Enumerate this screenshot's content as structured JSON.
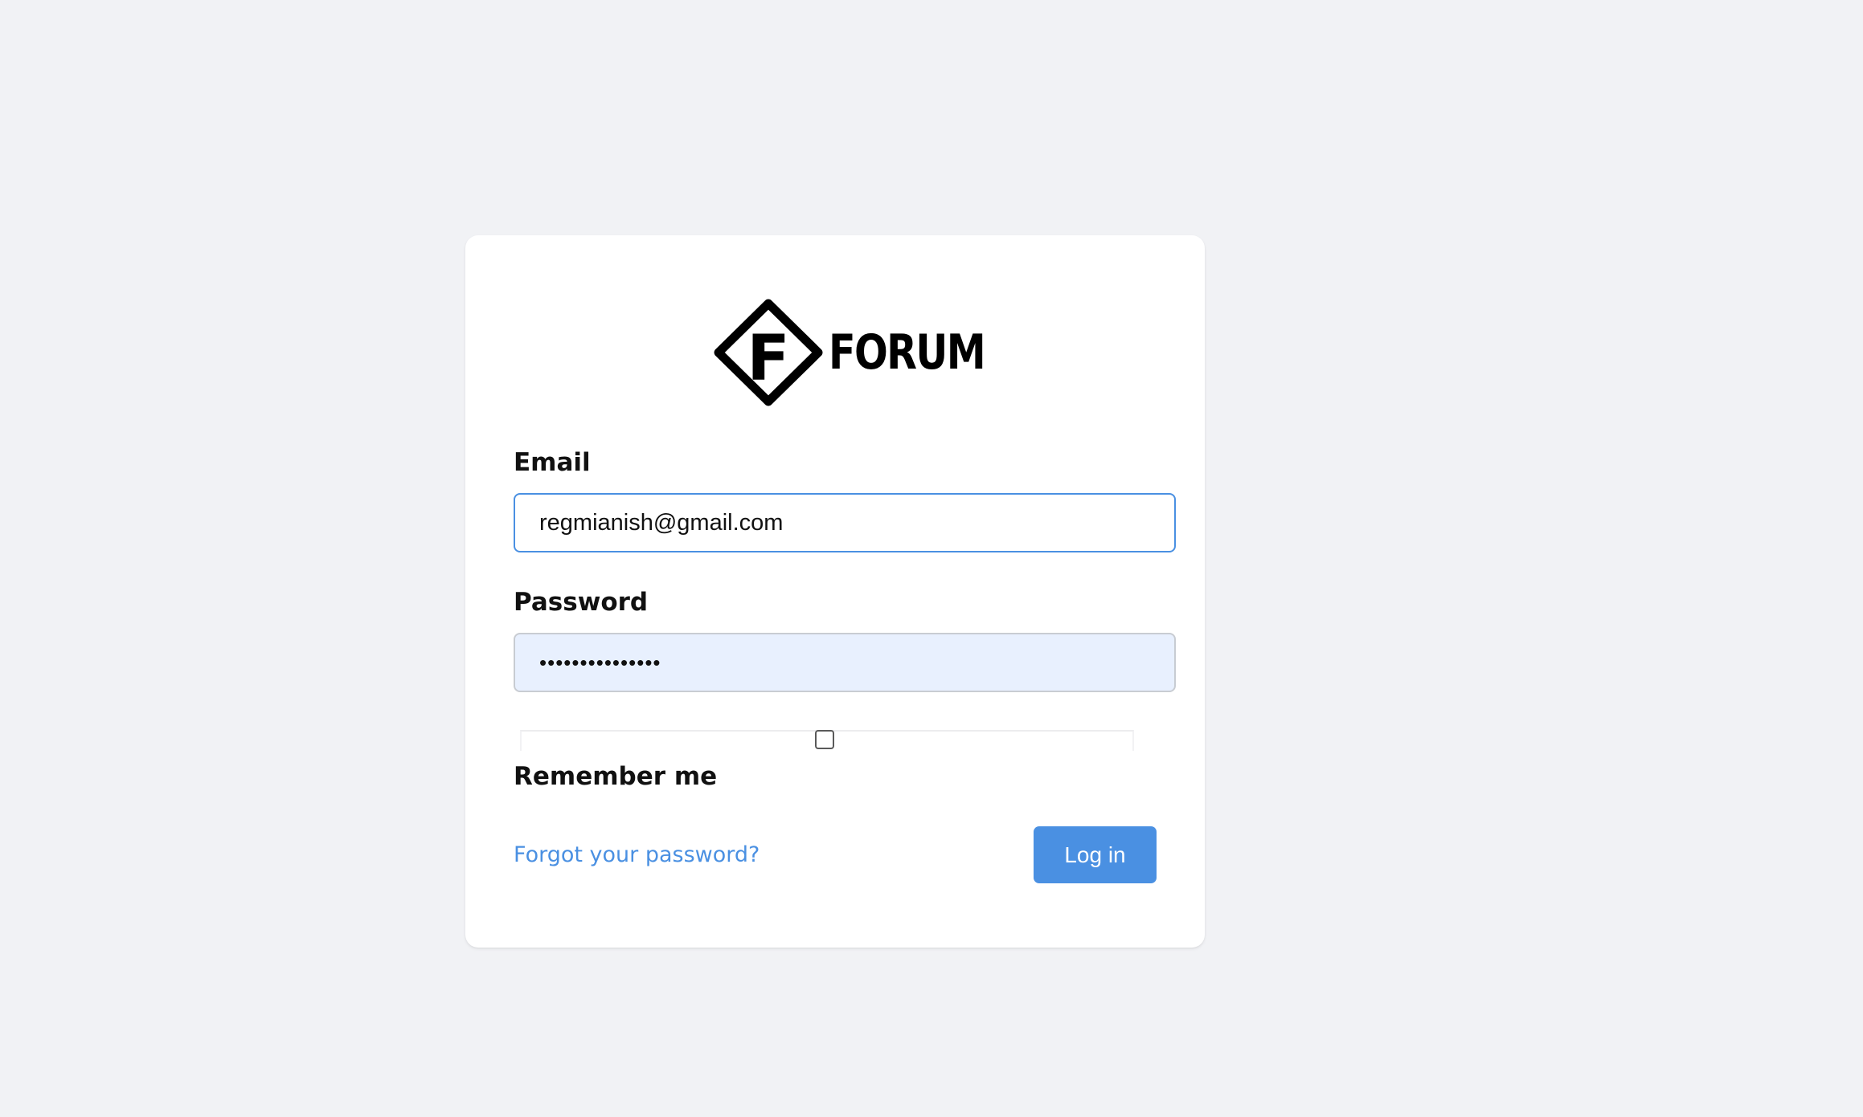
{
  "brand": {
    "name": "FORUM",
    "logo_letter": "F",
    "logo_icon": "diamond-f-logo-icon"
  },
  "form": {
    "email": {
      "label": "Email",
      "value": "regmianish@gmail.com"
    },
    "password": {
      "label": "Password",
      "value": "•••••••••••••••"
    },
    "remember": {
      "label": "Remember me",
      "checked": false
    },
    "forgot_link": "Forgot your password?",
    "submit_label": "Log in"
  },
  "colors": {
    "page_background": "#f1f2f5",
    "card_background": "#ffffff",
    "accent": "#4a90e2",
    "autofill_background": "#e8f0fe",
    "text": "#111111"
  }
}
